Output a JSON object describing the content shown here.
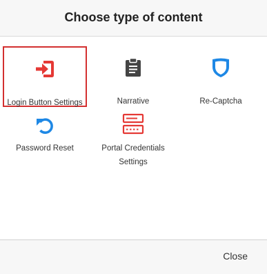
{
  "dialog": {
    "title": "Choose type of content"
  },
  "items": [
    {
      "label": "Login Button Settings",
      "icon": "login-icon",
      "color": "#e53935",
      "selected": true
    },
    {
      "label": "Narrative",
      "icon": "clipboard-icon",
      "color": "#444444",
      "selected": false
    },
    {
      "label": "Re-Captcha",
      "icon": "shield-icon",
      "color": "#1e88e5",
      "selected": false
    },
    {
      "label": "Password Reset",
      "icon": "undo-icon",
      "color": "#1e88e5",
      "selected": false
    },
    {
      "label": "Portal Credentials",
      "label_line2": "Settings",
      "icon": "server-icon",
      "color": "#e53935",
      "selected": false
    }
  ],
  "footer": {
    "close_label": "Close"
  },
  "colors": {
    "selected_border": "#d32f2f"
  }
}
